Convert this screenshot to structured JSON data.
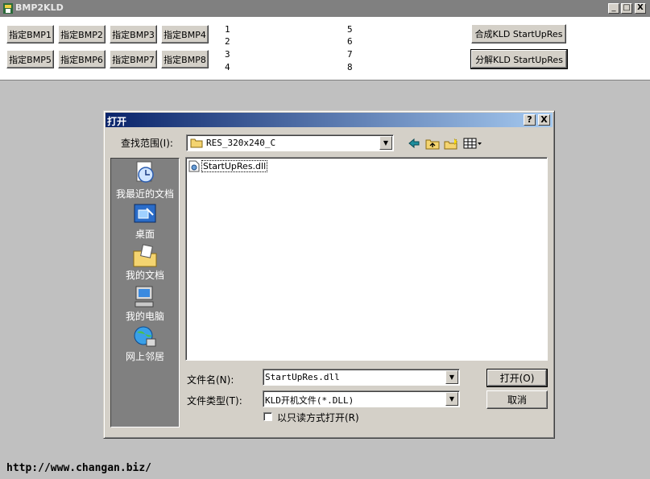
{
  "app": {
    "title": "BMP2KLD",
    "icon": "app-icon"
  },
  "window_controls": {
    "minimize": "_",
    "maximize": "□",
    "close": "X"
  },
  "bmp_buttons": [
    "指定BMP1",
    "指定BMP2",
    "指定BMP3",
    "指定BMP4",
    "指定BMP5",
    "指定BMP6",
    "指定BMP7",
    "指定BMP8"
  ],
  "slot_numbers": [
    "1",
    "2",
    "3",
    "4",
    "5",
    "6",
    "7",
    "8"
  ],
  "actions": {
    "merge": "合成KLD StartUpRes",
    "split": "分解KLD StartUpRes"
  },
  "dialog": {
    "title": "打开",
    "help": "?",
    "close": "X",
    "look_in_label": "查找范围(I):",
    "look_in_value": "RES_320x240_C",
    "places": [
      {
        "label": "我最近的文档",
        "icon": "recent-documents-icon"
      },
      {
        "label": "桌面",
        "icon": "desktop-icon"
      },
      {
        "label": "我的文档",
        "icon": "my-documents-icon"
      },
      {
        "label": "我的电脑",
        "icon": "my-computer-icon"
      },
      {
        "label": "网上邻居",
        "icon": "network-places-icon"
      }
    ],
    "files": [
      {
        "name": "StartUpRes.dll",
        "icon": "dll-file-icon"
      }
    ],
    "filename_label": "文件名(N):",
    "filename_value": "StartUpRes.dll",
    "filetype_label": "文件类型(T):",
    "filetype_value": "KLD开机文件(*.DLL)",
    "readonly_label": "以只读方式打开(R)",
    "open_button": "打开(O)",
    "cancel_button": "取消"
  },
  "footer_url": "http://www.changan.biz/",
  "colors": {
    "title_active_start": "#0a246a",
    "title_active_end": "#a6caf0",
    "face": "#d4d0c8",
    "background": "#c0c0c0"
  }
}
